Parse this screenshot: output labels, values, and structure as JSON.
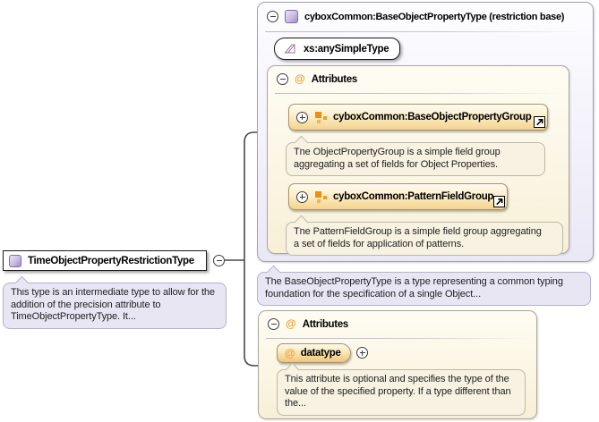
{
  "diagram": {
    "root": {
      "label": "TimeObjectPropertyRestrictionType",
      "description": "This type is an intermediate type to allow for the\naddition of the precision attribute to\nTimeObjectPropertyType. It..."
    },
    "base_type": {
      "label": "cyboxCommon:BaseObjectPropertyType (restriction base)",
      "base": "xs:anySimpleType",
      "description": "The BaseObjectPropertyType is a type representing a common typing\nfoundation for the specification of a single Object...",
      "attributes_section": {
        "label": "Attributes",
        "at_symbol": "@",
        "groups": [
          {
            "label": "cyboxCommon:BaseObjectPropertyGroup",
            "description": "The ObjectPropertyGroup is a simple field group\naggregating a set of fields for Object Properties."
          },
          {
            "label": "cyboxCommon:PatternFieldGroup",
            "description": "The PatternFieldGroup is a simple field group aggregating\na set of fields for application of patterns."
          }
        ]
      }
    },
    "attributes_section": {
      "label": "Attributes",
      "at_symbol": "@",
      "attributes": [
        {
          "name": "datatype",
          "at_symbol": "@",
          "description": "This attribute is optional and specifies the type of the\nvalue of the specified property. If a type different than\nthe..."
        }
      ]
    }
  },
  "icons": {
    "collapse": "minus-circle",
    "expand": "plus-circle",
    "complex_type": "purple-square",
    "simple_type": "hatched-parallelogram",
    "attribute_group": "orange-squares",
    "reference": "arrow-up-right"
  },
  "colors": {
    "accent_orange": "#ED9D34",
    "accent_purple": "#A18CCE",
    "panel_cream": "#FBF5E3",
    "panel_lavender": "#EDEBF7",
    "tooltip_lavender": "#E9E6F4",
    "tooltip_cream": "#F7F2E1"
  }
}
